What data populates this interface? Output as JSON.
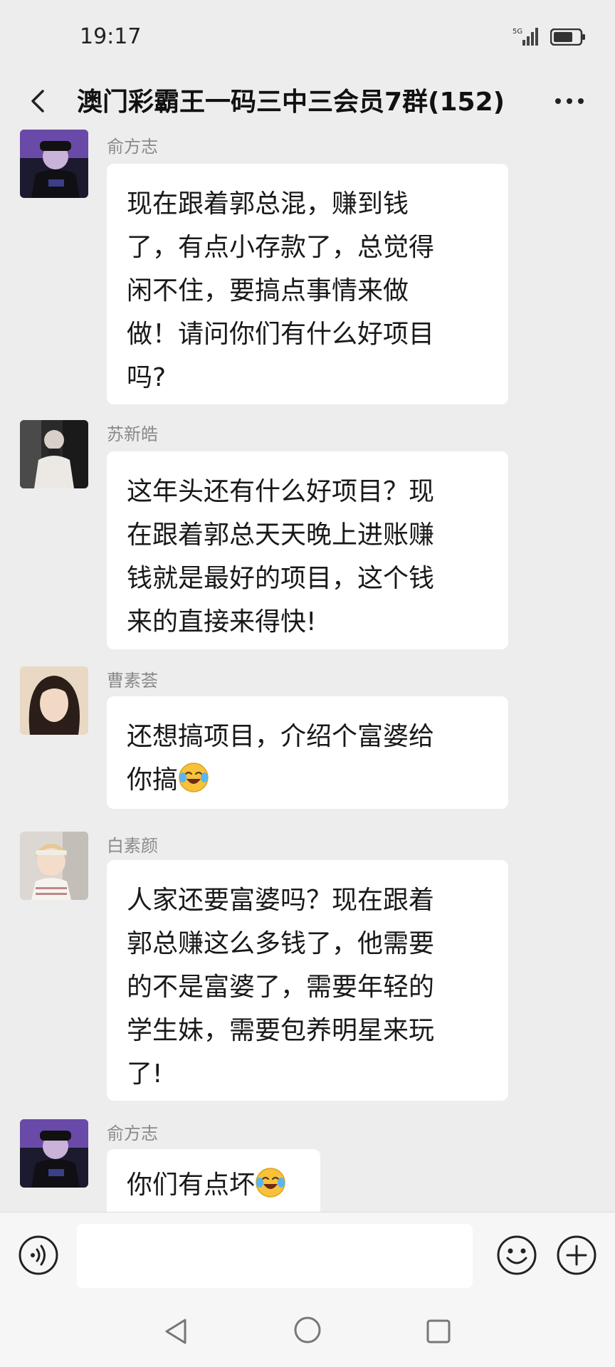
{
  "status_bar": {
    "time": "19:17",
    "network": "5G"
  },
  "header": {
    "title": "澳门彩霸王一码三中三会员7群(152)"
  },
  "messages": [
    {
      "sender": "俞方志",
      "text": "现在跟着郭总混，赚到钱\n了，有点小存款了，总觉得\n闲不住，要搞点事情来做\n做！请问你们有什么好项目\n吗?"
    },
    {
      "sender": "苏新皓",
      "text": "这年头还有什么好项目？现\n在跟着郭总天天晚上进账赚\n钱就是最好的项目，这个钱\n来的直接来得快!"
    },
    {
      "sender": "曹素荟",
      "text": "还想搞项目，介绍个富婆给\n你搞",
      "emoji": "laughing-crying-emoji"
    },
    {
      "sender": "白素颜",
      "text": "人家还要富婆吗？现在跟着\n郭总赚这么多钱了，他需要\n的不是富婆了，需要年轻的\n学生妹，需要包养明星来玩\n了!"
    },
    {
      "sender": "俞方志",
      "text": "你们有点坏",
      "emoji": "laughing-crying-emoji"
    }
  ],
  "input": {
    "placeholder": "",
    "value": ""
  },
  "icons": {
    "back": "chevron-left-icon",
    "more": "more-dots-icon",
    "voice": "voice-icon",
    "emoji": "smiley-icon",
    "plus": "plus-icon"
  },
  "colors": {
    "background": "#ededed",
    "bubble": "#ffffff",
    "sender": "#8a8a8a",
    "text": "#191919"
  }
}
